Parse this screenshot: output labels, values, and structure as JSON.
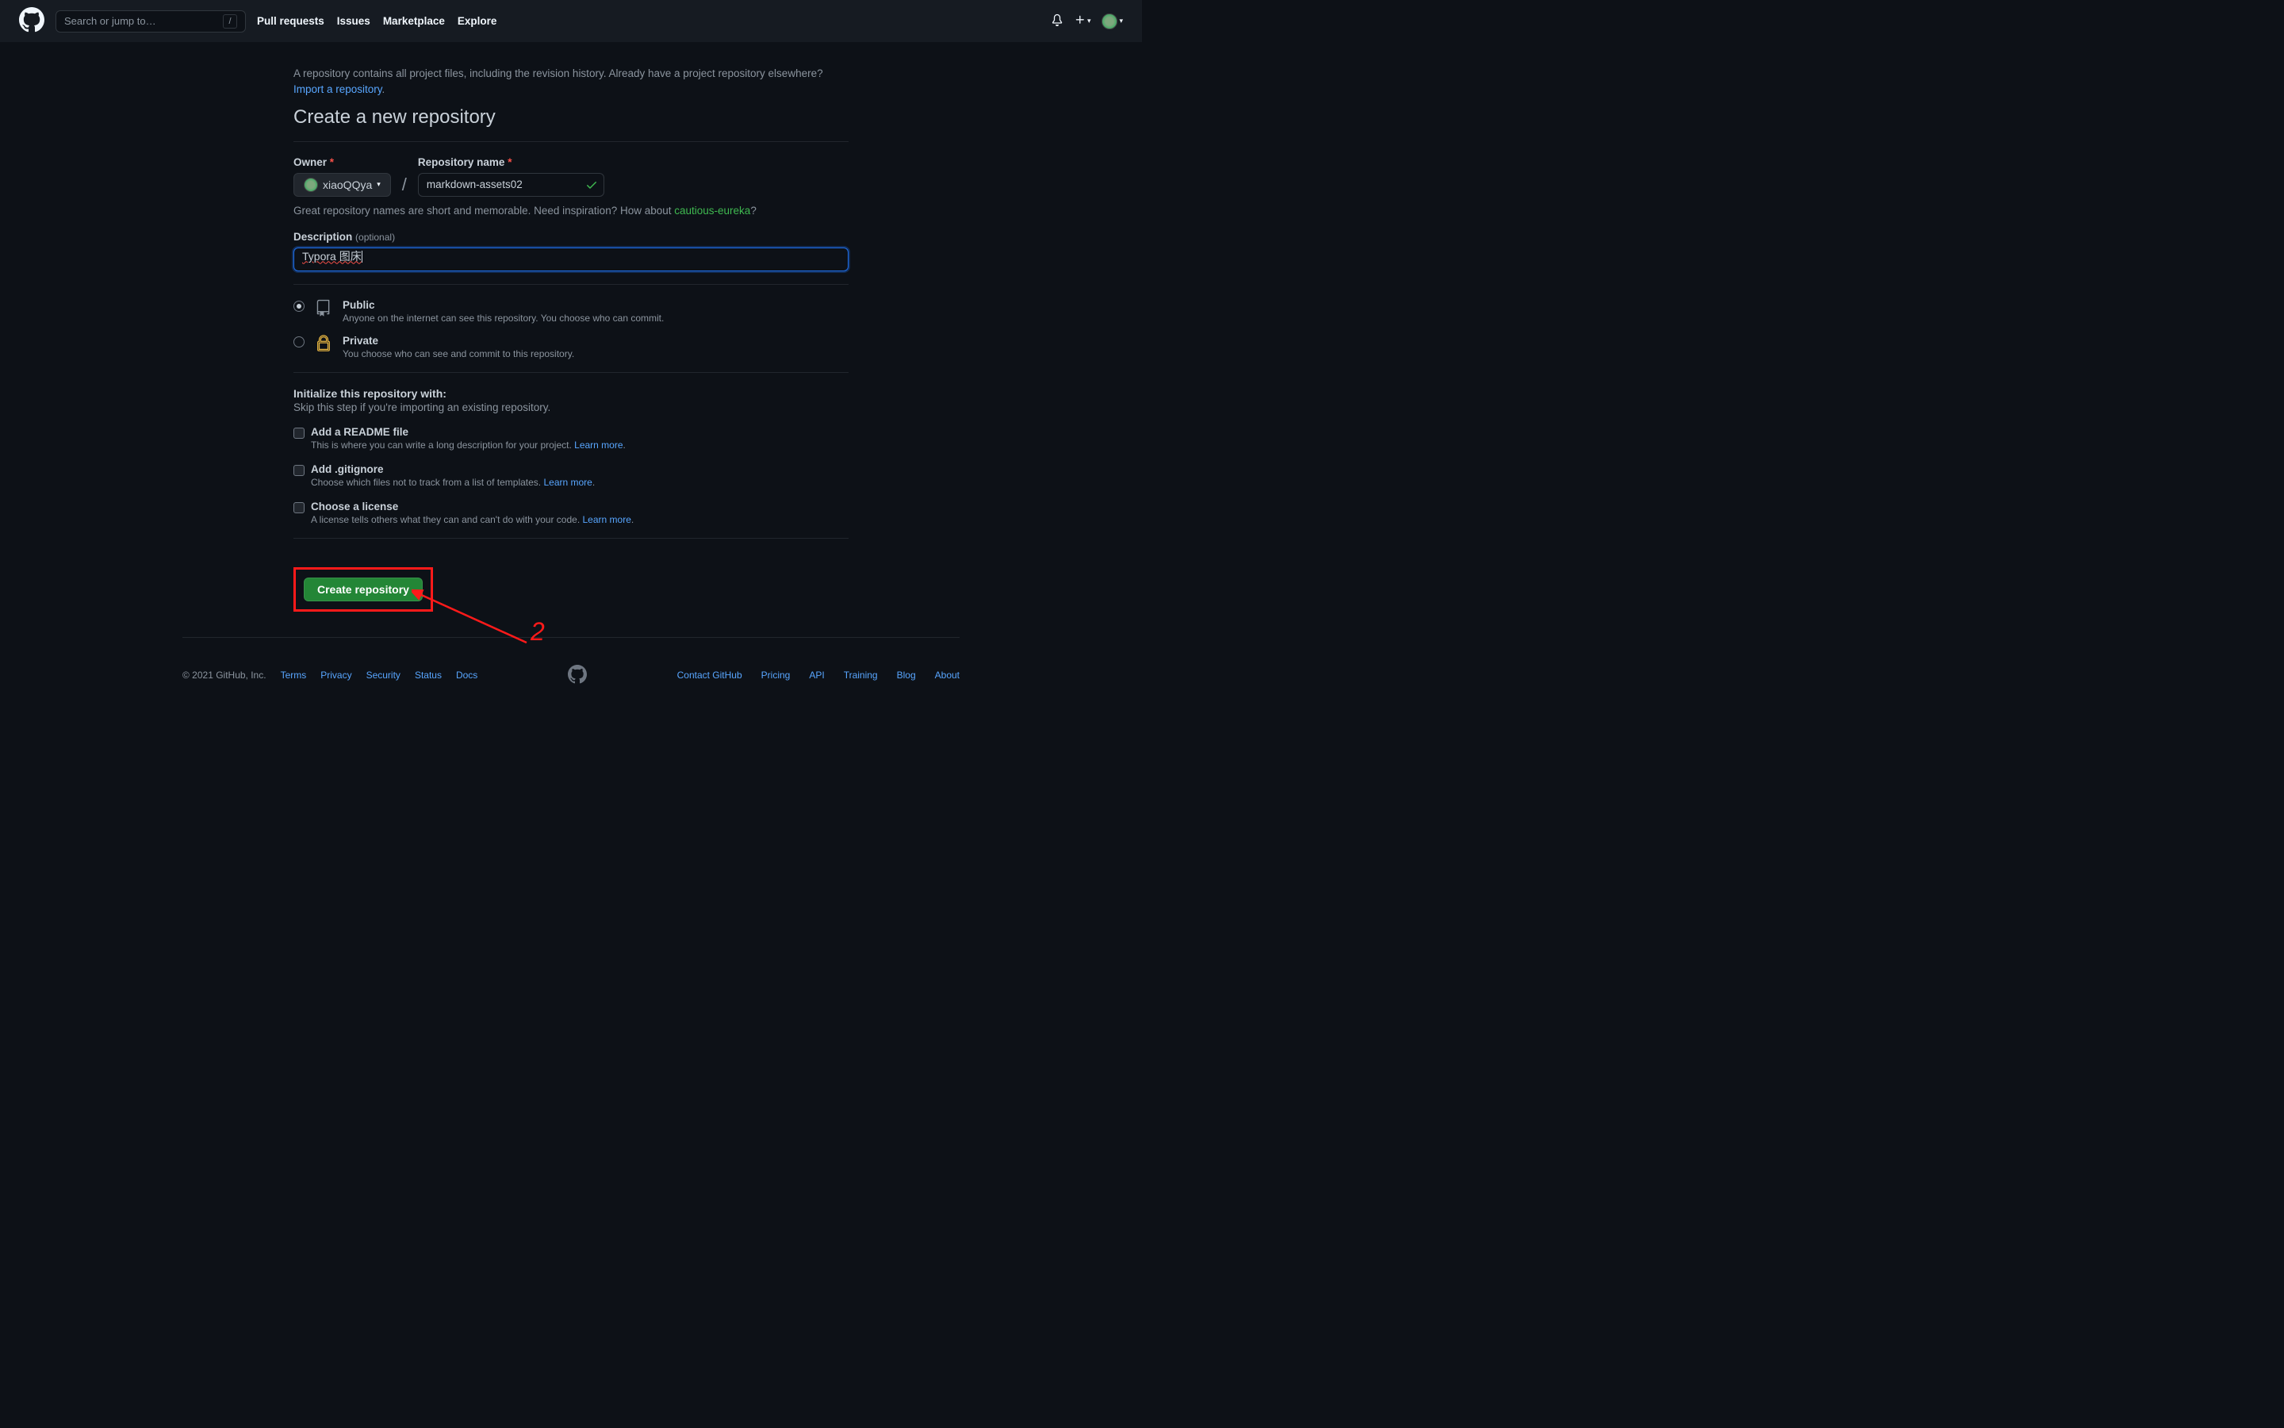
{
  "header": {
    "search_placeholder": "Search or jump to…",
    "slash": "/",
    "nav": [
      "Pull requests",
      "Issues",
      "Marketplace",
      "Explore"
    ]
  },
  "intro": {
    "text": "A repository contains all project files, including the revision history. Already have a project repository elsewhere?",
    "import_link": "Import a repository"
  },
  "page_title": "Create a new repository",
  "owner": {
    "label": "Owner",
    "value": "xiaoQQya"
  },
  "repo": {
    "label": "Repository name",
    "value": "markdown-assets02"
  },
  "hint": {
    "pre": "Great repository names are short and memorable. Need inspiration? How about ",
    "suggestion": "cautious-eureka",
    "post": "?"
  },
  "description": {
    "label": "Description",
    "optional": "(optional)",
    "value": "Typora 图床"
  },
  "visibility": {
    "public": {
      "title": "Public",
      "sub": "Anyone on the internet can see this repository. You choose who can commit."
    },
    "private": {
      "title": "Private",
      "sub": "You choose who can see and commit to this repository."
    }
  },
  "init": {
    "title": "Initialize this repository with:",
    "sub": "Skip this step if you're importing an existing repository."
  },
  "checkboxes": {
    "readme": {
      "title": "Add a README file",
      "sub": "This is where you can write a long description for your project. ",
      "link": "Learn more"
    },
    "gitignore": {
      "title": "Add .gitignore",
      "sub": "Choose which files not to track from a list of templates. ",
      "link": "Learn more"
    },
    "license": {
      "title": "Choose a license",
      "sub": "A license tells others what they can and can't do with your code. ",
      "link": "Learn more"
    }
  },
  "create_button": "Create repository",
  "annotation_number": "2",
  "footer": {
    "copyright": "© 2021 GitHub, Inc.",
    "left": [
      "Terms",
      "Privacy",
      "Security",
      "Status",
      "Docs"
    ],
    "right": [
      "Contact GitHub",
      "Pricing",
      "API",
      "Training",
      "Blog",
      "About"
    ]
  }
}
